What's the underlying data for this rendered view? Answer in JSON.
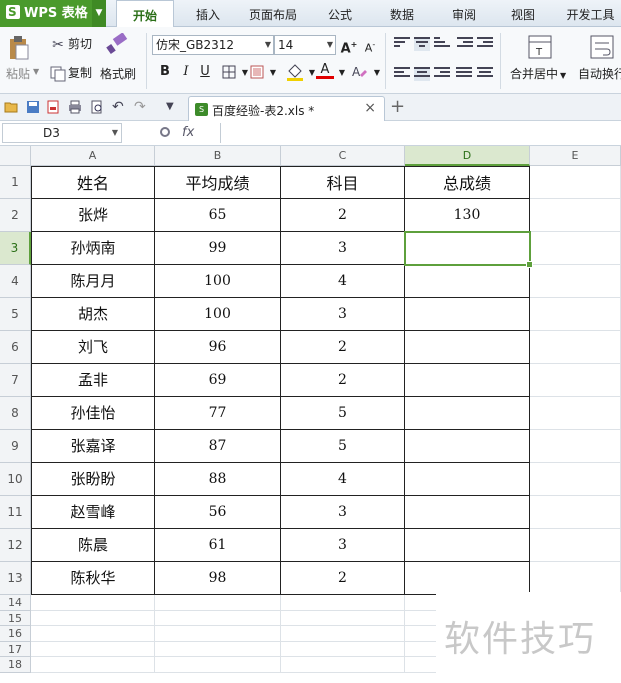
{
  "app": {
    "name": "WPS 表格",
    "logo_letter": "S"
  },
  "ribbon_tabs": [
    "开始",
    "插入",
    "页面布局",
    "公式",
    "数据",
    "审阅",
    "视图",
    "开发工具"
  ],
  "ribbon": {
    "paste": "粘贴",
    "cut": "剪切",
    "copy": "复制",
    "format_painter": "格式刷",
    "font_name": "仿宋_GB2312",
    "font_size": "14",
    "bold": "B",
    "italic": "I",
    "underline": "U",
    "font_color_letter": "A",
    "merge_center": "合并居中",
    "wrap_text": "自动换行"
  },
  "document": {
    "tab_title": "百度经验-表2.xls *"
  },
  "formula_bar": {
    "cell_ref": "D3",
    "fx": "fx",
    "value": ""
  },
  "columns": [
    "A",
    "B",
    "C",
    "D",
    "E"
  ],
  "rows": [
    "1",
    "2",
    "3",
    "4",
    "5",
    "6",
    "7",
    "8",
    "9",
    "10",
    "11",
    "12",
    "13",
    "14",
    "15",
    "16",
    "17",
    "18"
  ],
  "table": {
    "headers": [
      "姓名",
      "平均成绩",
      "科目",
      "总成绩"
    ],
    "records": [
      [
        "张烨",
        "65",
        "2",
        "130"
      ],
      [
        "孙炳南",
        "99",
        "3",
        ""
      ],
      [
        "陈月月",
        "100",
        "4",
        ""
      ],
      [
        "胡杰",
        "100",
        "3",
        ""
      ],
      [
        "刘飞",
        "96",
        "2",
        ""
      ],
      [
        "孟非",
        "69",
        "2",
        ""
      ],
      [
        "孙佳怡",
        "77",
        "5",
        ""
      ],
      [
        "张嘉译",
        "87",
        "5",
        ""
      ],
      [
        "张盼盼",
        "88",
        "4",
        ""
      ],
      [
        "赵雪峰",
        "56",
        "3",
        ""
      ],
      [
        "陈晨",
        "61",
        "3",
        ""
      ],
      [
        "陈秋华",
        "98",
        "2",
        ""
      ]
    ]
  },
  "selection": {
    "column": "D",
    "row": "3"
  },
  "watermark": "软件技巧",
  "colors": {
    "accent": "#4a9a2c",
    "selection": "#5ea03c"
  }
}
